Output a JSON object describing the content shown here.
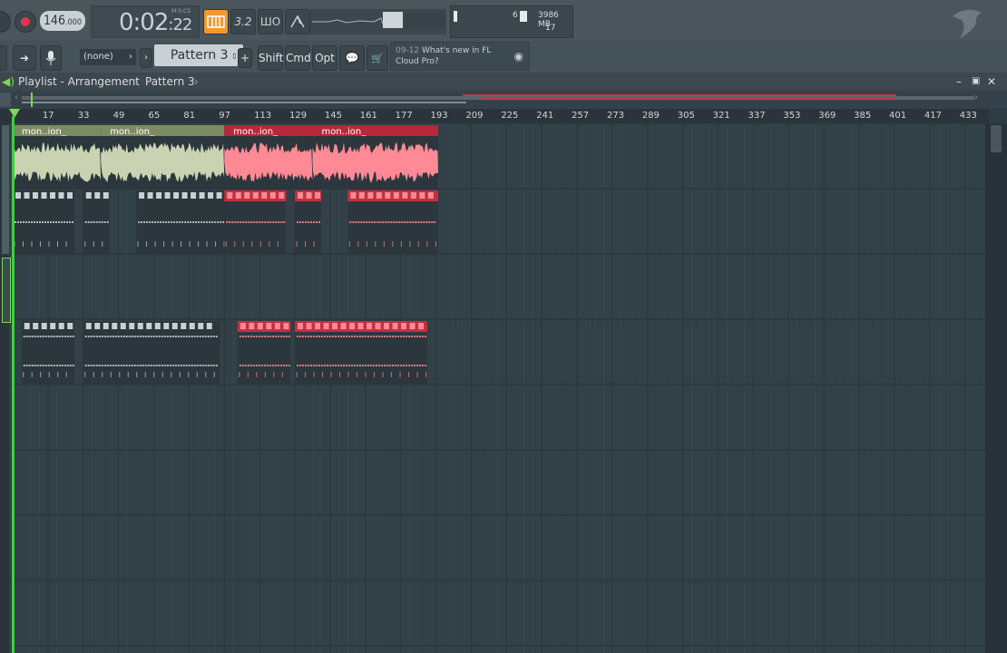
{
  "transport": {
    "tempo": "146",
    "tempo_dec": ".000",
    "time_main": "0:02",
    "time_sub": ":22",
    "time_label": "M:S:CS",
    "btn_wave": "3.2",
    "btn_loop": "ШΟ",
    "cpu": "6",
    "mem": "3986 MB",
    "poly": "17"
  },
  "toolbar": {
    "none_label": "(none)",
    "pattern_label": "Pattern 3",
    "plus": "+",
    "shift": "Shift",
    "cmd": "Cmd",
    "opt": "Opt",
    "news_date": "09-12",
    "news_line1": "What's new in FL",
    "news_line2": "Cloud Pro?"
  },
  "playlist": {
    "title": "Playlist - Arrangement",
    "sep": "›",
    "pattern": "Pattern 3",
    "ruler": [
      "17",
      "33",
      "49",
      "65",
      "81",
      "97",
      "113",
      "129",
      "145",
      "161",
      "177",
      "193",
      "209",
      "225",
      "241",
      "257",
      "273",
      "289",
      "305",
      "321",
      "337",
      "353",
      "369",
      "385",
      "401",
      "417",
      "433"
    ],
    "clip_names": [
      "mon..ion_",
      "mon..ion_",
      "mon..ion_",
      "mon..ion_"
    ]
  },
  "colors": {
    "clip_green": "#c9d3b2",
    "clip_green_header": "#7d8b63",
    "clip_red": "#ff8a95",
    "clip_red_header": "#b8283a",
    "playhead": "#3bd13b"
  }
}
